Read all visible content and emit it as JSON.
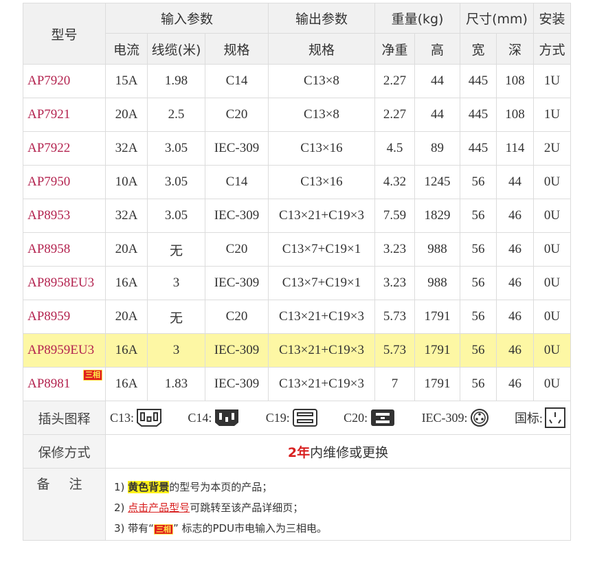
{
  "header": {
    "model": "型号",
    "input_group": "输入参数",
    "output_group": "输出参数",
    "weight_group": "重量(kg)",
    "size_group": "尺寸(mm)",
    "install_top": "安装",
    "current": "电流",
    "cable": "线缆(米)",
    "input_spec": "规格",
    "output_spec": "规格",
    "net_weight": "净重",
    "height": "高",
    "width": "宽",
    "depth": "深",
    "install_bottom": "方式"
  },
  "rows": [
    {
      "model": "AP7920",
      "current": "15A",
      "cable": "1.98",
      "input": "C14",
      "output": "C13×8",
      "weight": "2.27",
      "h": "44",
      "w": "445",
      "d": "108",
      "mount": "1U"
    },
    {
      "model": "AP7921",
      "current": "20A",
      "cable": "2.5",
      "input": "C20",
      "output": "C13×8",
      "weight": "2.27",
      "h": "44",
      "w": "445",
      "d": "108",
      "mount": "1U"
    },
    {
      "model": "AP7922",
      "current": "32A",
      "cable": "3.05",
      "input": "IEC-309",
      "output": "C13×16",
      "weight": "4.5",
      "h": "89",
      "w": "445",
      "d": "114",
      "mount": "2U"
    },
    {
      "model": "AP7950",
      "current": "10A",
      "cable": "3.05",
      "input": "C14",
      "output": "C13×16",
      "weight": "4.32",
      "h": "1245",
      "w": "56",
      "d": "44",
      "mount": "0U"
    },
    {
      "model": "AP8953",
      "current": "32A",
      "cable": "3.05",
      "input": "IEC-309",
      "output": "C13×21+C19×3",
      "weight": "7.59",
      "h": "1829",
      "w": "56",
      "d": "46",
      "mount": "0U"
    },
    {
      "model": "AP8958",
      "current": "20A",
      "cable": "无",
      "input": "C20",
      "output": "C13×7+C19×1",
      "weight": "3.23",
      "h": "988",
      "w": "56",
      "d": "46",
      "mount": "0U"
    },
    {
      "model": "AP8958EU3",
      "current": "16A",
      "cable": "3",
      "input": "IEC-309",
      "output": "C13×7+C19×1",
      "weight": "3.23",
      "h": "988",
      "w": "56",
      "d": "46",
      "mount": "0U"
    },
    {
      "model": "AP8959",
      "current": "20A",
      "cable": "无",
      "input": "C20",
      "output": "C13×21+C19×3",
      "weight": "5.73",
      "h": "1791",
      "w": "56",
      "d": "46",
      "mount": "0U"
    },
    {
      "model": "AP8959EU3",
      "current": "16A",
      "cable": "3",
      "input": "IEC-309",
      "output": "C13×21+C19×3",
      "weight": "5.73",
      "h": "1791",
      "w": "56",
      "d": "46",
      "mount": "0U"
    },
    {
      "model": "AP8981",
      "badge": "三相",
      "current": "16A",
      "cable": "1.83",
      "input": "IEC-309",
      "output": "C13×21+C19×3",
      "weight": "7",
      "h": "1791",
      "w": "56",
      "d": "46",
      "mount": "0U"
    }
  ],
  "plugs": {
    "label": "插头图释",
    "c13": "C13:",
    "c14": "C14:",
    "c19": "C19:",
    "c20": "C20:",
    "iec309": "IEC-309:",
    "national": "国标:"
  },
  "warranty": {
    "label": "保修方式",
    "years": "2年",
    "text": "内维修或更换"
  },
  "notes": {
    "label": "备注",
    "n1_prefix": "1) ",
    "n1_hl": "黄色背景",
    "n1_rest": "的型号为本页的产品；",
    "n2_prefix": "2) ",
    "n2_link": "点击产品型号",
    "n2_rest": "可跳转至该产品详细页；",
    "n3_prefix": "3) 带有“",
    "n3_badge": "三相",
    "n3_rest": "” 标志的PDU市电输入为三相电。"
  },
  "colors": {
    "model_link": "#b3234f",
    "highlight_row": "#fdf7a4",
    "badge_bg": "#e01e1e",
    "badge_text": "#ffe94a"
  }
}
